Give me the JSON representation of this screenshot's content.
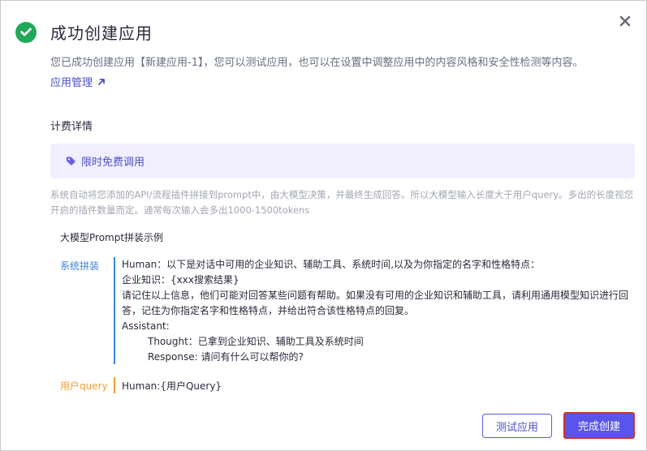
{
  "dialog": {
    "title": "成功创建应用",
    "description": "您已成功创建应用【新建应用-1】，您可以测试应用，也可以在设置中调整应用中的内容风格和安全性检测等内容。",
    "manage_link": "应用管理",
    "icons": {
      "success": "check-circle-icon",
      "close": "close-icon",
      "link": "arrow-up-right-icon",
      "tag": "tag-icon"
    },
    "colors": {
      "accent": "#5a55ea",
      "success": "#22a85a",
      "system": "#3a86d6",
      "user": "#f0a030"
    }
  },
  "billing": {
    "section_title": "计费详情",
    "free_label": "限时免费调用",
    "note": "系统自动将您添加的API/流程插件拼接到prompt中，由大模型决策，并最终生成回答。所以大模型输入长度大于用户query。多出的长度视您开启的插件数量而定。通常每次输入会多出1000-1500tokens"
  },
  "example": {
    "title": "大模型Prompt拼装示例",
    "system": {
      "label": "系统拼装",
      "line1": "Human：以下是对话中可用的企业知识、辅助工具、系统时间,以及为你指定的名字和性格特点：",
      "line2": "企业知识：{xxx搜索结果}",
      "line3": "请记住以上信息，他们可能对回答某些问题有帮助。如果没有可用的企业知识和辅助工具，请利用通用模型知识进行回答，记住为你指定名字和性格特点，并给出符合该性格特点的回复。",
      "line4": "Assistant:",
      "line5": "Thought：已拿到企业知识、辅助工具及系统时间",
      "line6": "Response: 请问有什么可以帮你的?"
    },
    "user": {
      "label": "用户query",
      "content": "Human:{用户Query}"
    }
  },
  "footer": {
    "test_button": "测试应用",
    "done_button": "完成创建"
  }
}
